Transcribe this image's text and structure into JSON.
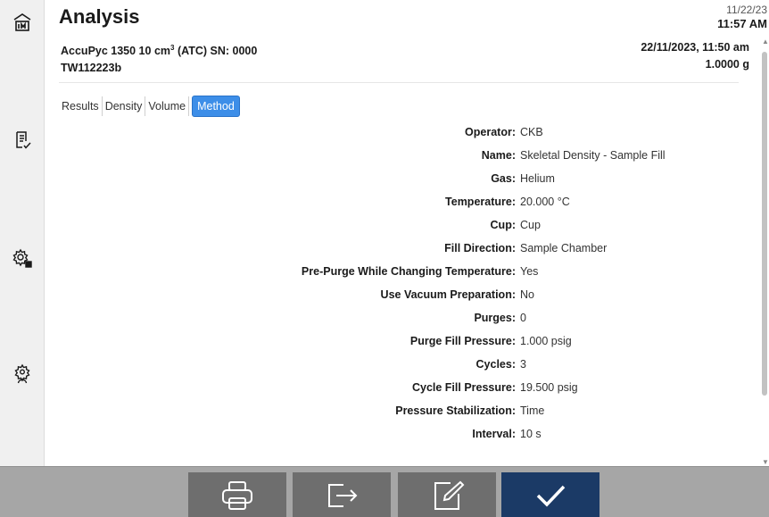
{
  "header": {
    "title": "Analysis"
  },
  "clock": {
    "date": "11/22/23",
    "time": "11:57 AM"
  },
  "info": {
    "instrument_prefix": "AccuPyc 1350 10 cm",
    "instrument_sup": "3",
    "instrument_suffix": " (ATC) SN: 0000",
    "sample_id": "TW112223b",
    "datetime": "22/11/2023, 11:50 am",
    "mass": "1.0000 g"
  },
  "tabs": [
    {
      "label": "Results",
      "active": false
    },
    {
      "label": "Density",
      "active": false
    },
    {
      "label": "Volume",
      "active": false
    },
    {
      "label": "Method",
      "active": true
    }
  ],
  "method": [
    {
      "label": "Operator:",
      "value": "CKB"
    },
    {
      "label": "Name:",
      "value": "Skeletal Density - Sample Fill"
    },
    {
      "label": "Gas:",
      "value": "Helium"
    },
    {
      "label": "Temperature:",
      "value": "20.000 °C"
    },
    {
      "label": "Cup:",
      "value": "Cup"
    },
    {
      "label": "Fill Direction:",
      "value": "Sample Chamber"
    },
    {
      "label": "Pre-Purge While Changing Temperature:",
      "value": "Yes"
    },
    {
      "label": "Use Vacuum Preparation:",
      "value": "No"
    },
    {
      "label": "Purges:",
      "value": "0"
    },
    {
      "label": "Purge Fill Pressure:",
      "value": "1.000 psig"
    },
    {
      "label": "Cycles:",
      "value": "3"
    },
    {
      "label": "Cycle Fill Pressure:",
      "value": "19.500 psig"
    },
    {
      "label": "Pressure Stabilization:",
      "value": "Time"
    },
    {
      "label": "Interval:",
      "value": "10 s"
    }
  ],
  "sidebar": {
    "items": [
      {
        "icon": "home-icon"
      },
      {
        "icon": "report-check-icon"
      },
      {
        "icon": "settings-grid-icon"
      },
      {
        "icon": "user-settings-icon"
      }
    ]
  },
  "footer": {
    "buttons": [
      {
        "icon": "print-icon"
      },
      {
        "icon": "export-icon"
      },
      {
        "icon": "edit-icon"
      },
      {
        "icon": "check-icon"
      }
    ]
  },
  "colors": {
    "tab_active": "#3d8ee8",
    "footer_bg": "#a6a6a6",
    "footer_button": "#6e6e6e",
    "primary_button": "#1b3a66"
  }
}
